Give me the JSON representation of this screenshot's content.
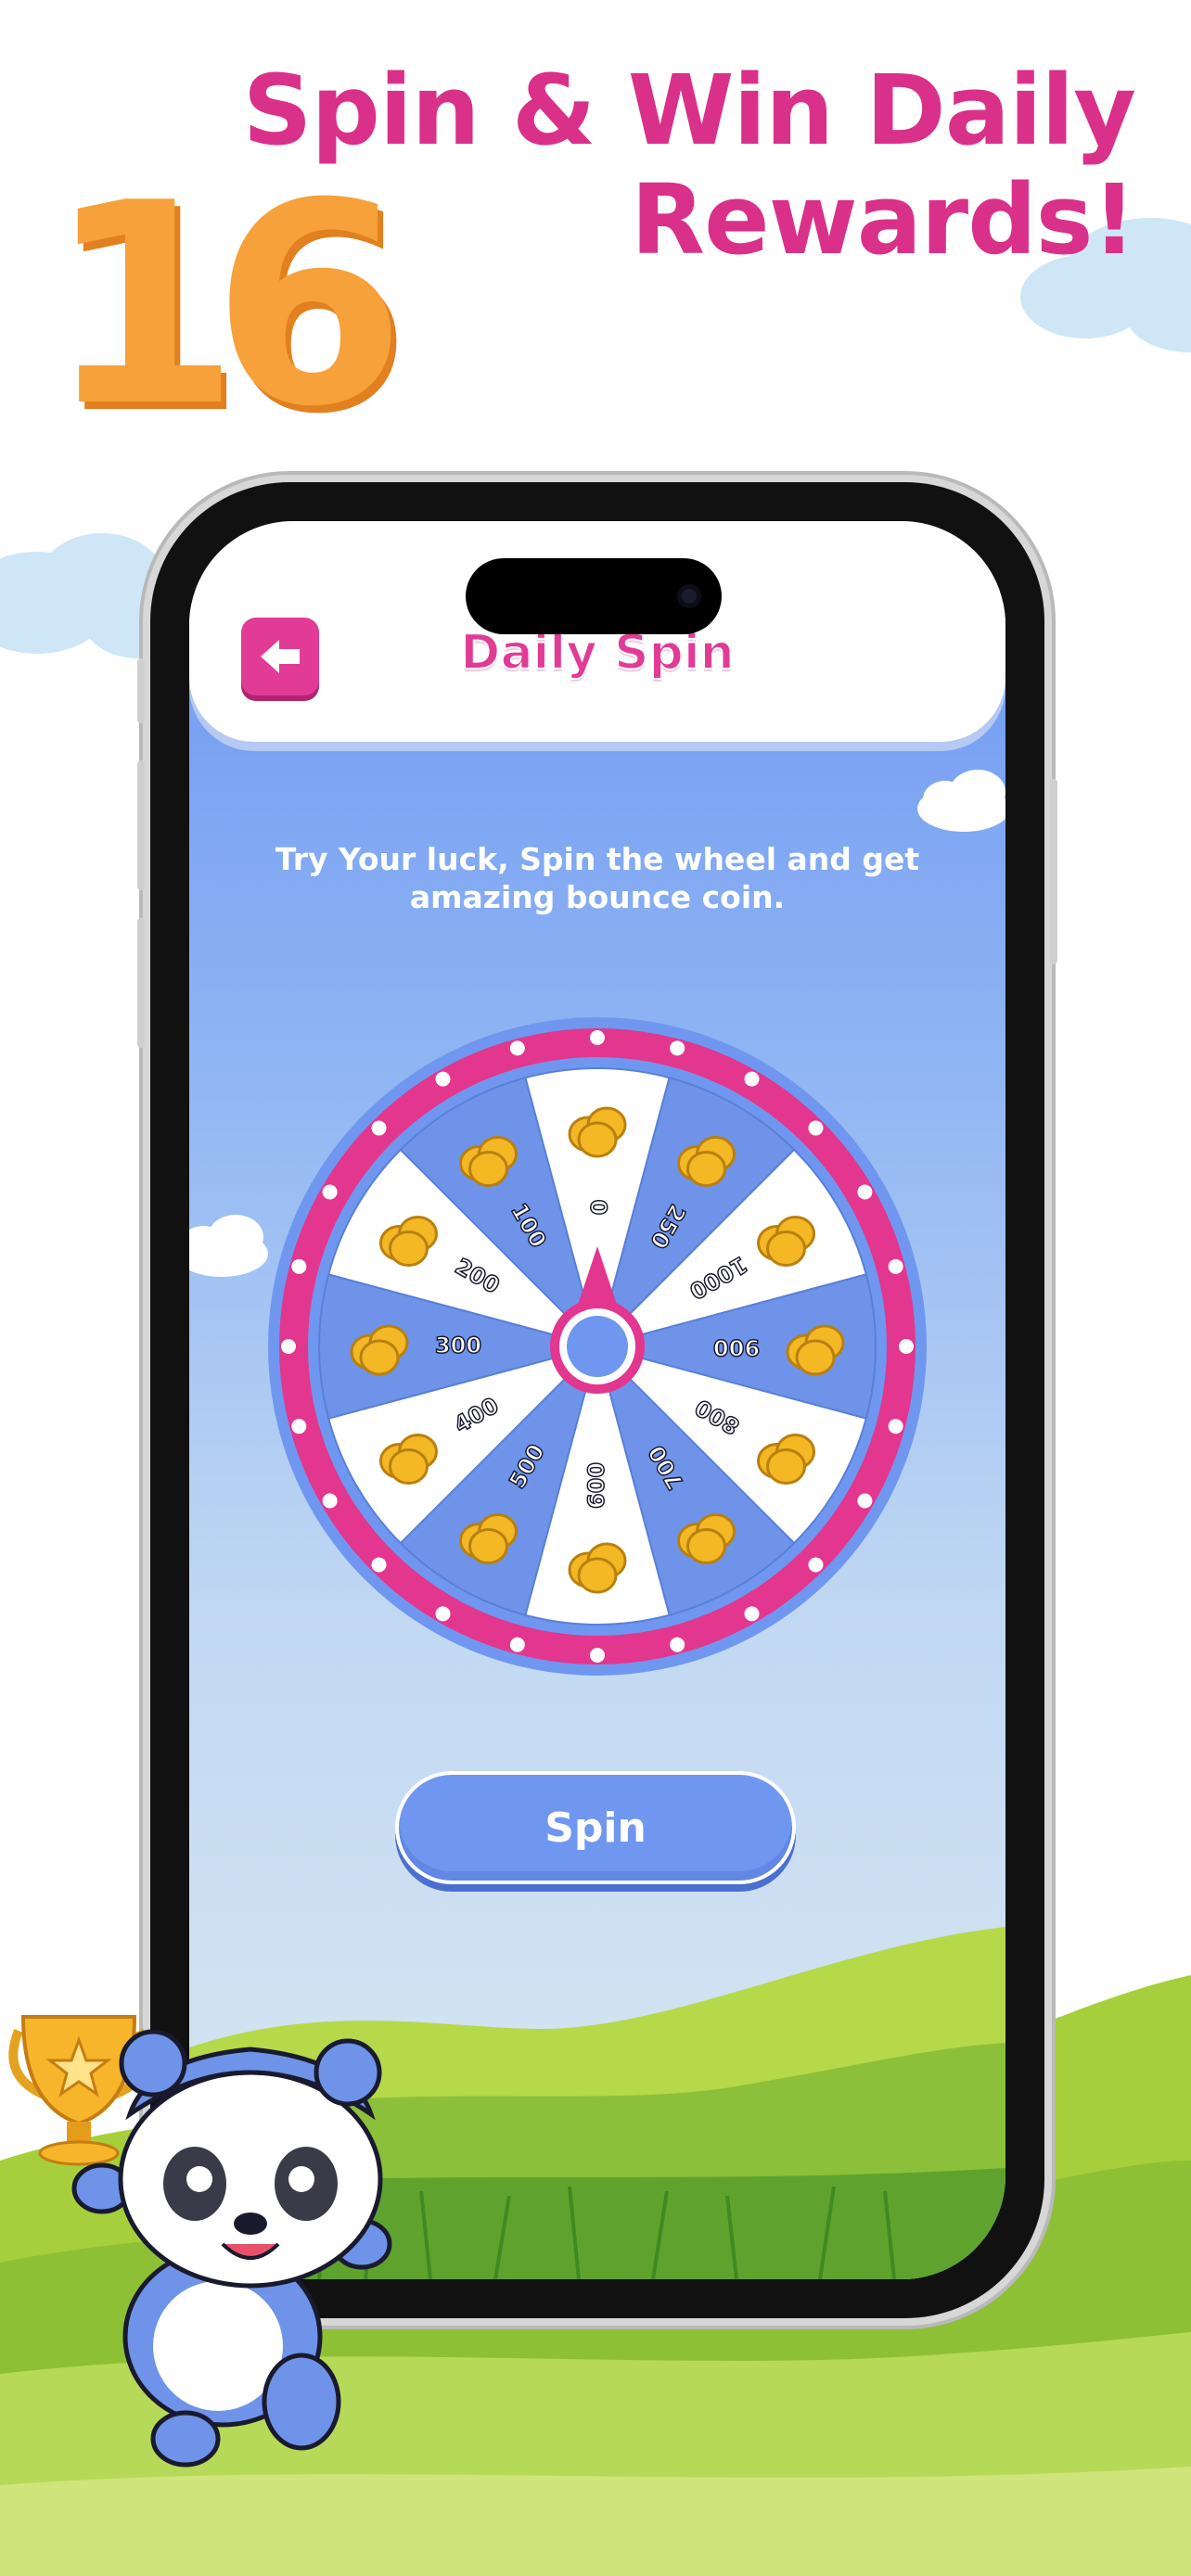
{
  "headline": {
    "line1": "Spin & Win Daily",
    "line2": "Rewards!"
  },
  "screenshot_number": "16",
  "app": {
    "header": {
      "title": "Daily Spin",
      "back_icon": "arrow-left-icon"
    },
    "subtitle": {
      "line1": "Try Your luck, Spin the wheel and get",
      "line2": "amazing bounce coin."
    },
    "wheel": {
      "segments": [
        "0",
        "250",
        "1000",
        "900",
        "800",
        "700",
        "600",
        "500",
        "400",
        "300",
        "200",
        "100"
      ],
      "reward_icon": "gold-coins-icon",
      "colors": {
        "rim": "#e3368e",
        "light_segment": "#ffffff",
        "dark_segment": "#6f93e8",
        "pointer": "#e3368e"
      }
    },
    "spin_button": {
      "label": "Spin"
    }
  },
  "colors": {
    "brand_pink": "#d9318a",
    "accent_blue": "#7097ef",
    "number_orange": "#f6a13a"
  }
}
